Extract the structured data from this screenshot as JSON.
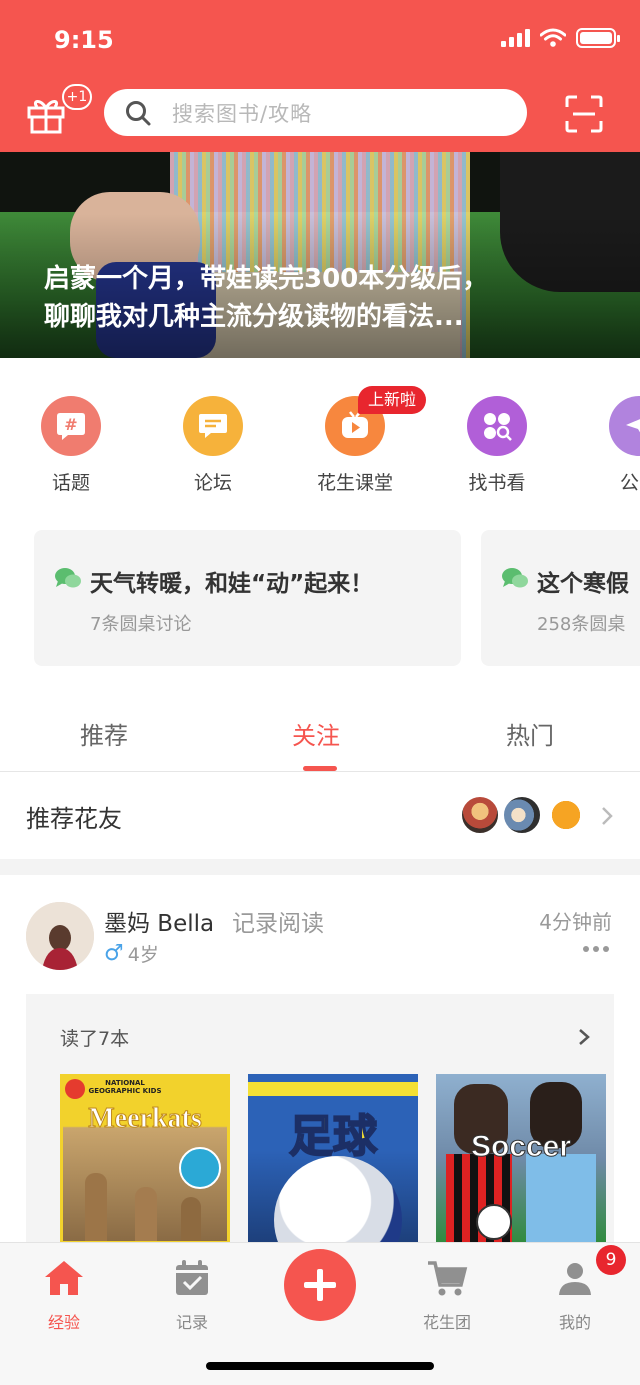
{
  "status_bar": {
    "time": "9:15"
  },
  "header": {
    "gift_badge": "+1",
    "search_placeholder": "搜索图书/攻略"
  },
  "banner": {
    "title_line1": "启蒙一个月，带娃读完300本分级后，",
    "title_line2": "聊聊我对几种主流分级读物的看法..."
  },
  "quick_menu": {
    "items": [
      {
        "label": "话题",
        "icon": "hashtag-icon",
        "color": "#f07c6f"
      },
      {
        "label": "论坛",
        "icon": "chat-bubble-icon",
        "color": "#f6b23b"
      },
      {
        "label": "花生课堂",
        "icon": "tv-play-icon",
        "color": "#f7873e"
      },
      {
        "label": "找书看",
        "icon": "grid-search-icon",
        "color": "#b15fd8"
      },
      {
        "label": "公众",
        "icon": "send-icon",
        "color": "#b183de"
      }
    ],
    "new_badge": "上新啦"
  },
  "round_tables": [
    {
      "title": "天气转暖，和娃“动”起来！",
      "subtitle": "7条圆桌讨论"
    },
    {
      "title": "这个寒假",
      "subtitle": "258条圆桌"
    }
  ],
  "tabs": {
    "items": [
      "推荐",
      "关注",
      "热门"
    ],
    "active": "关注"
  },
  "recommend_friends": {
    "title": "推荐花友"
  },
  "post": {
    "author": "墨妈 Bella",
    "action": "记录阅读",
    "time": "4分钟前",
    "child_gender_icon": "♂",
    "child_age": "4岁",
    "read_count": "读了7本",
    "books": [
      {
        "cover_text": "Meerkats",
        "publisher_text": "NATIONAL GEOGRAPHIC KIDS"
      },
      {
        "cover_text": "足球"
      },
      {
        "cover_text": "Soccer"
      }
    ]
  },
  "bottom_nav": {
    "items": [
      {
        "label": "经验",
        "icon": "home-icon",
        "active": true
      },
      {
        "label": "记录",
        "icon": "calendar-check-icon",
        "active": false
      },
      {
        "label": "花生团",
        "icon": "cart-icon",
        "active": false
      },
      {
        "label": "我的",
        "icon": "user-icon",
        "active": false
      }
    ],
    "profile_badge": "9"
  },
  "colors": {
    "brand": "#f5554f",
    "badge_red": "#e8262e"
  }
}
